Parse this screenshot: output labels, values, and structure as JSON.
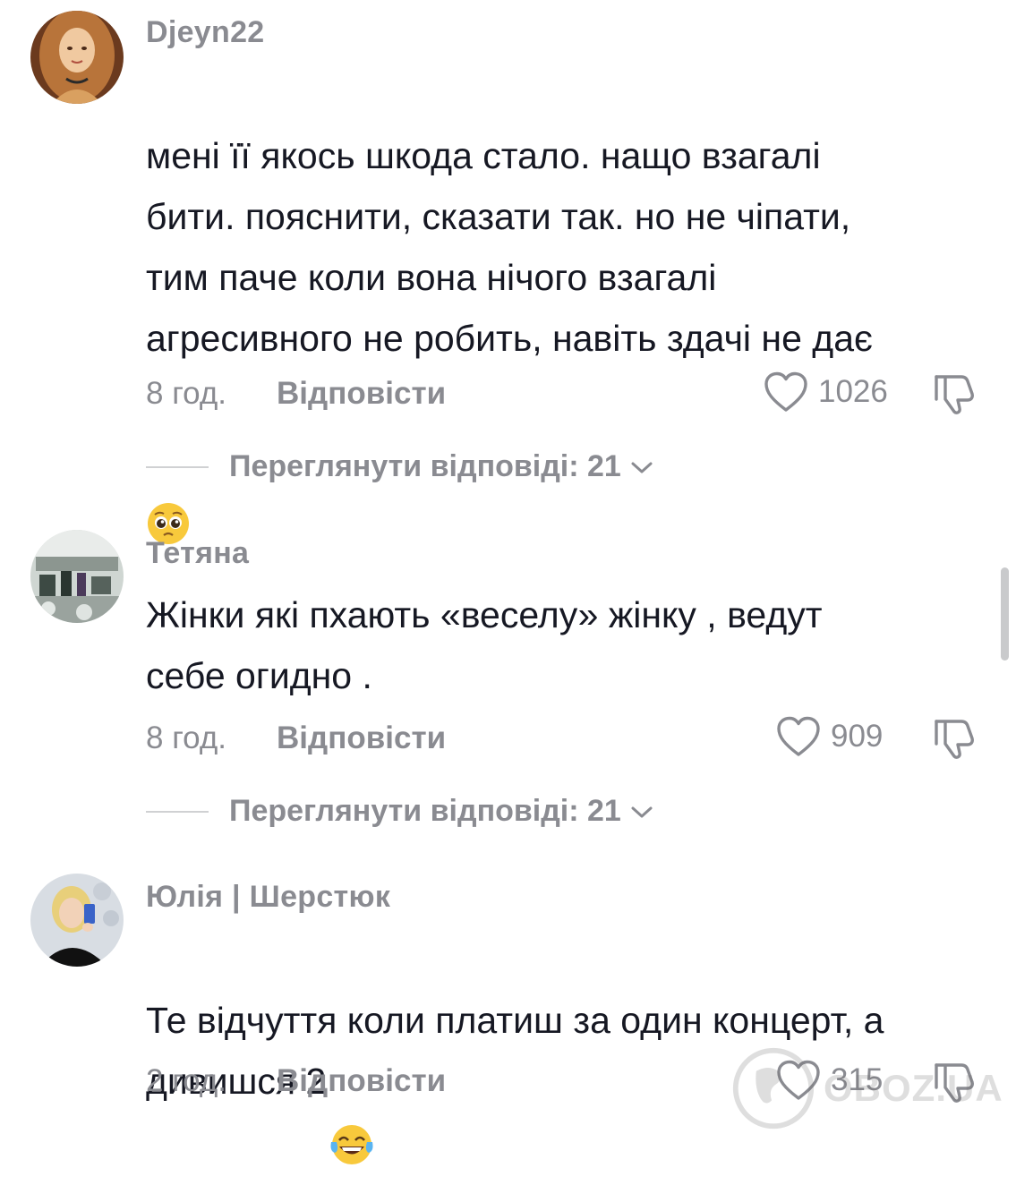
{
  "comments": [
    {
      "username": "Djeyn22",
      "text": "мені її якось шкода стало. нащо взагалі\nбити. пояснити, сказати так. но не чіпати,\nтим паче коли вона нічого взагалі\nагресивного не робить, навіть здачі не дає",
      "emoji": "pleading-face-emoji",
      "time": "8 год.",
      "reply_label": "Відповісти",
      "likes": "1026",
      "view_replies": "Переглянути відповіді: 21"
    },
    {
      "username": "Тетяна",
      "text": "Жінки які пхають «веселу» жінку , ведут\nсебе огидно .",
      "time": "8 год.",
      "reply_label": "Відповісти",
      "likes": "909",
      "view_replies": "Переглянути відповіді: 21"
    },
    {
      "username": "Юлія | Шерстюк",
      "text": "Те відчуття коли платиш за один концерт, а\nдивишся 2",
      "emoji": "tears-of-joy-emoji",
      "time": "2 год.",
      "reply_label": "Відповісти",
      "likes": "315"
    }
  ],
  "watermark": {
    "text": "OBOZ.UA"
  },
  "colors": {
    "text": "#161823",
    "secondary": "#8a8b91",
    "divider": "#d0d1d3"
  }
}
